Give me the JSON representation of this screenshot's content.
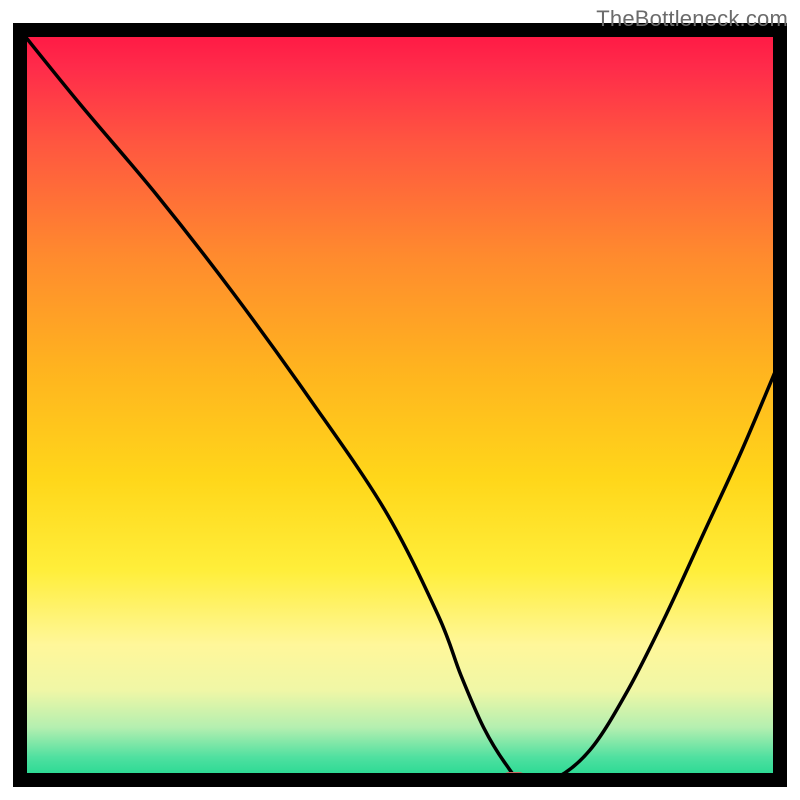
{
  "watermark": "TheBottleneck.com",
  "chart_data": {
    "type": "line",
    "title": "",
    "xlabel": "",
    "ylabel": "",
    "xlim": [
      0,
      100
    ],
    "ylim": [
      0,
      100
    ],
    "x": [
      0,
      8,
      18,
      28,
      38,
      48,
      55,
      58,
      61,
      64,
      66,
      70,
      75,
      80,
      85,
      90,
      95,
      100
    ],
    "y": [
      100,
      90,
      78,
      65,
      51,
      36,
      22,
      14,
      7,
      2,
      0,
      0,
      4,
      12,
      22,
      33,
      44,
      56
    ],
    "marker": {
      "x": 65,
      "y": 0
    },
    "gradient_stops": [
      {
        "offset": 0.0,
        "color": "#ff1744"
      },
      {
        "offset": 0.05,
        "color": "#ff2b4a"
      },
      {
        "offset": 0.15,
        "color": "#ff5640"
      },
      {
        "offset": 0.3,
        "color": "#ff8a2e"
      },
      {
        "offset": 0.45,
        "color": "#ffb31f"
      },
      {
        "offset": 0.6,
        "color": "#ffd71a"
      },
      {
        "offset": 0.72,
        "color": "#ffee3a"
      },
      {
        "offset": 0.82,
        "color": "#fff79a"
      },
      {
        "offset": 0.88,
        "color": "#f0f7a6"
      },
      {
        "offset": 0.93,
        "color": "#b4efb0"
      },
      {
        "offset": 0.97,
        "color": "#4fe0a0"
      },
      {
        "offset": 1.0,
        "color": "#1fd890"
      }
    ],
    "axis_color": "#000000",
    "line_color": "#000000",
    "marker_color": "#c96b62"
  }
}
